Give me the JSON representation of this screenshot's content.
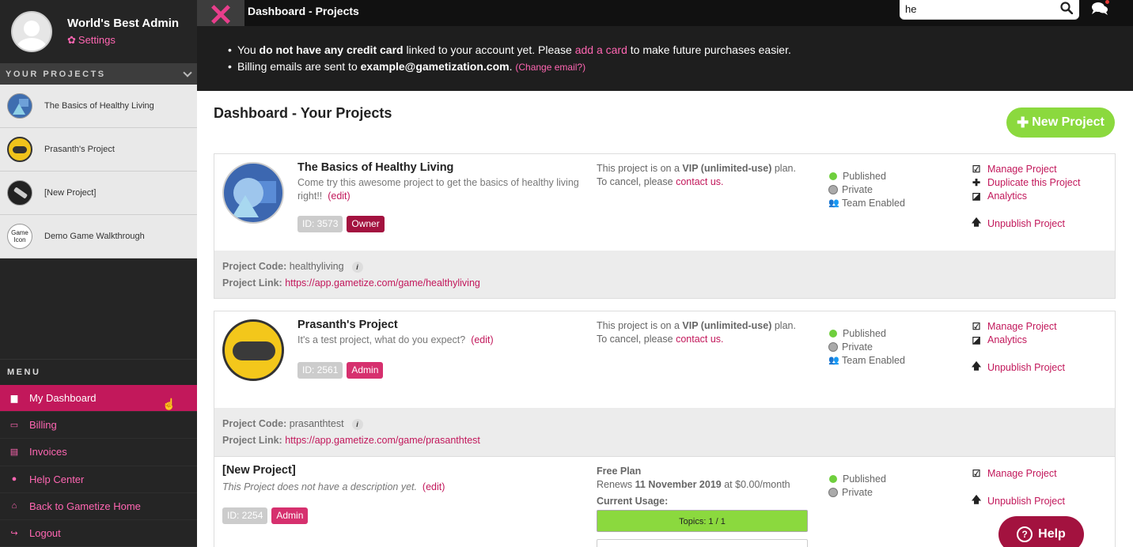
{
  "profile": {
    "username": "World's Best Admin",
    "settings_label": "Settings"
  },
  "sidebar": {
    "projects_header": "YOUR PROJECTS",
    "projects": [
      {
        "name": "The Basics of Healthy Living",
        "icon": "healthy-living-thumb"
      },
      {
        "name": "Prasanth's Project",
        "icon": "gamepad-thumb"
      },
      {
        "name": "[New Project]",
        "icon": "stick-thumb"
      },
      {
        "name": "Demo Game Walkthrough",
        "icon": "game-icon-thumb",
        "thumb_text": "Game Icon"
      }
    ],
    "menu_title": "MENU",
    "menu": [
      {
        "label": "My Dashboard",
        "icon": "briefcase-icon",
        "active": true
      },
      {
        "label": "Billing",
        "icon": "credit-card-icon"
      },
      {
        "label": "Invoices",
        "icon": "file-icon"
      },
      {
        "label": "Help Center",
        "icon": "question-icon"
      },
      {
        "label": "Back to Gametize Home",
        "icon": "home-icon"
      },
      {
        "label": "Logout",
        "icon": "logout-icon"
      }
    ]
  },
  "topbar": {
    "title": "Dashboard - Projects",
    "search_value": "he"
  },
  "notice": {
    "line1_pre": "You ",
    "line1_bold": "do not have any credit card",
    "line1_mid": " linked to your account yet. Please ",
    "line1_link": "add a card",
    "line1_post": " to make future purchases easier.",
    "line2_pre": "Billing emails are sent to ",
    "line2_email": "example@gametization.com",
    "line2_dot": ".",
    "line2_link": "(Change email?)"
  },
  "main": {
    "title": "Dashboard - Your Projects",
    "new_project_label": "New Project"
  },
  "cards": [
    {
      "title": "The Basics of Healthy Living",
      "desc": "Come try this awesome project to get the basics of healthy living right!!",
      "edit": "(edit)",
      "id": "ID: 3573",
      "role": "Owner",
      "plan_pre": "This project is on a ",
      "plan_bold": "VIP (unlimited-use)",
      "plan_post": " plan.",
      "cancel_pre": "To cancel, please ",
      "cancel_link": "contact us.",
      "status": [
        "Published",
        "Private",
        "Team Enabled"
      ],
      "actions": [
        "Manage Project",
        "Duplicate this Project",
        "Analytics"
      ],
      "unpublish": "Unpublish Project",
      "code_label": "Project Code:",
      "code": "healthyliving",
      "link_label": "Project Link:",
      "link": "https://app.gametize.com/game/healthyliving"
    },
    {
      "title": "Prasanth's Project",
      "desc": "It's a test project, what do you expect?",
      "edit": "(edit)",
      "id": "ID: 2561",
      "role": "Admin",
      "plan_pre": "This project is on a ",
      "plan_bold": "VIP (unlimited-use)",
      "plan_post": " plan.",
      "cancel_pre": "To cancel, please ",
      "cancel_link": "contact us.",
      "status": [
        "Published",
        "Private",
        "Team Enabled"
      ],
      "actions": [
        "Manage Project",
        "Analytics"
      ],
      "unpublish": "Unpublish Project",
      "code_label": "Project Code:",
      "code": "prasanthtest",
      "link_label": "Project Link:",
      "link": "https://app.gametize.com/game/prasanthtest"
    },
    {
      "title": "[New Project]",
      "desc": "This Project does not have a description yet.",
      "edit": "(edit)",
      "id": "ID: 2254",
      "role": "Admin",
      "plan_name": "Free Plan",
      "renews_pre": "Renews ",
      "renews_bold": "11 November 2019",
      "renews_post": " at $0.00/month",
      "usage_label": "Current Usage:",
      "usage_bar": "Topics: 1 / 1",
      "usage_fraction": 1.0,
      "status": [
        "Published",
        "Private"
      ],
      "actions": [
        "Manage Project"
      ],
      "unpublish": "Unpublish Project"
    }
  ],
  "help_label": "Help",
  "colors": {
    "accent": "#c2185b",
    "link_pink": "#ff66b2",
    "green": "#8bd93e",
    "sidebar": "#252525"
  }
}
